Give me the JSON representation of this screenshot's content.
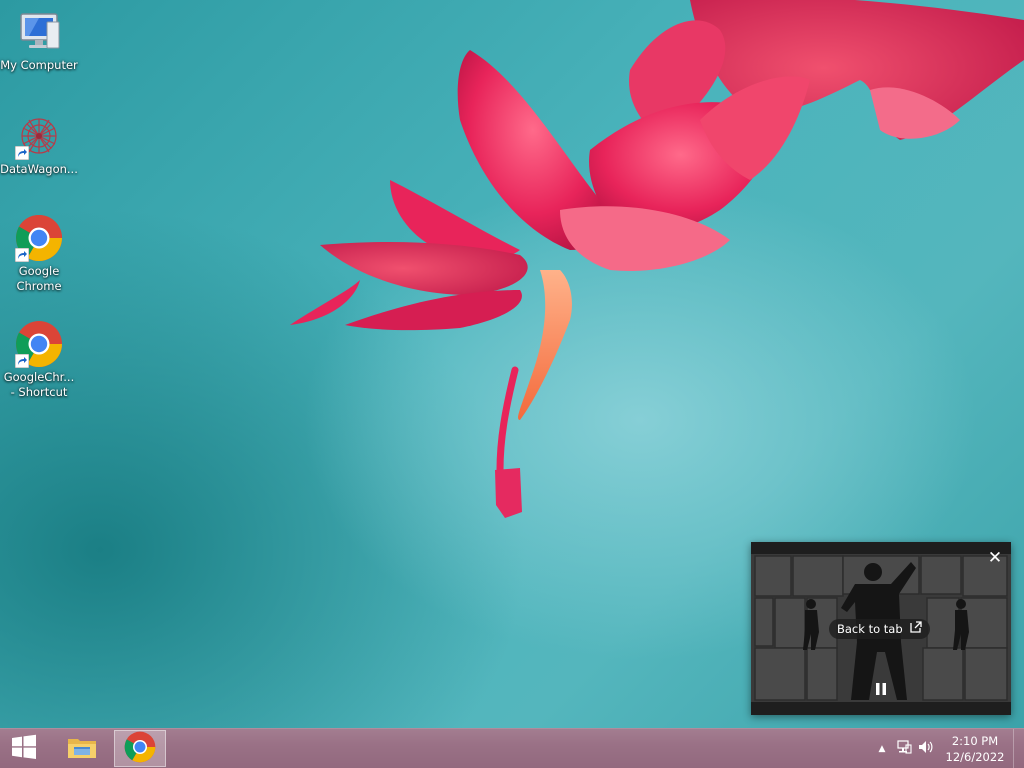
{
  "desktop_icons": [
    {
      "label": "My Computer",
      "icon": "computer-icon",
      "shortcut": false
    },
    {
      "label": "DataWagon...",
      "icon": "datawagon-icon",
      "shortcut": true
    },
    {
      "label": "Google\nChrome",
      "icon": "chrome-icon",
      "shortcut": true
    },
    {
      "label": "GoogleChr...\n- Shortcut",
      "icon": "chrome-icon",
      "shortcut": true
    }
  ],
  "pip": {
    "back_to_tab_label": "Back to tab",
    "close_glyph": "✕",
    "state": "playing"
  },
  "taskbar": {
    "apps": [
      {
        "name": "File Explorer",
        "icon": "folder-icon",
        "active": false
      },
      {
        "name": "Google Chrome",
        "icon": "chrome-icon",
        "active": true
      }
    ],
    "tray": {
      "overflow_glyph": "▲",
      "icons": [
        "network-icon",
        "speaker-icon"
      ]
    },
    "clock": {
      "time": "2:10 PM",
      "date": "12/6/2022"
    }
  },
  "colors": {
    "wallpaper_teal": "#4bb4bc",
    "flower_pink": "#e8245a",
    "taskbar": "#9a7186"
  }
}
